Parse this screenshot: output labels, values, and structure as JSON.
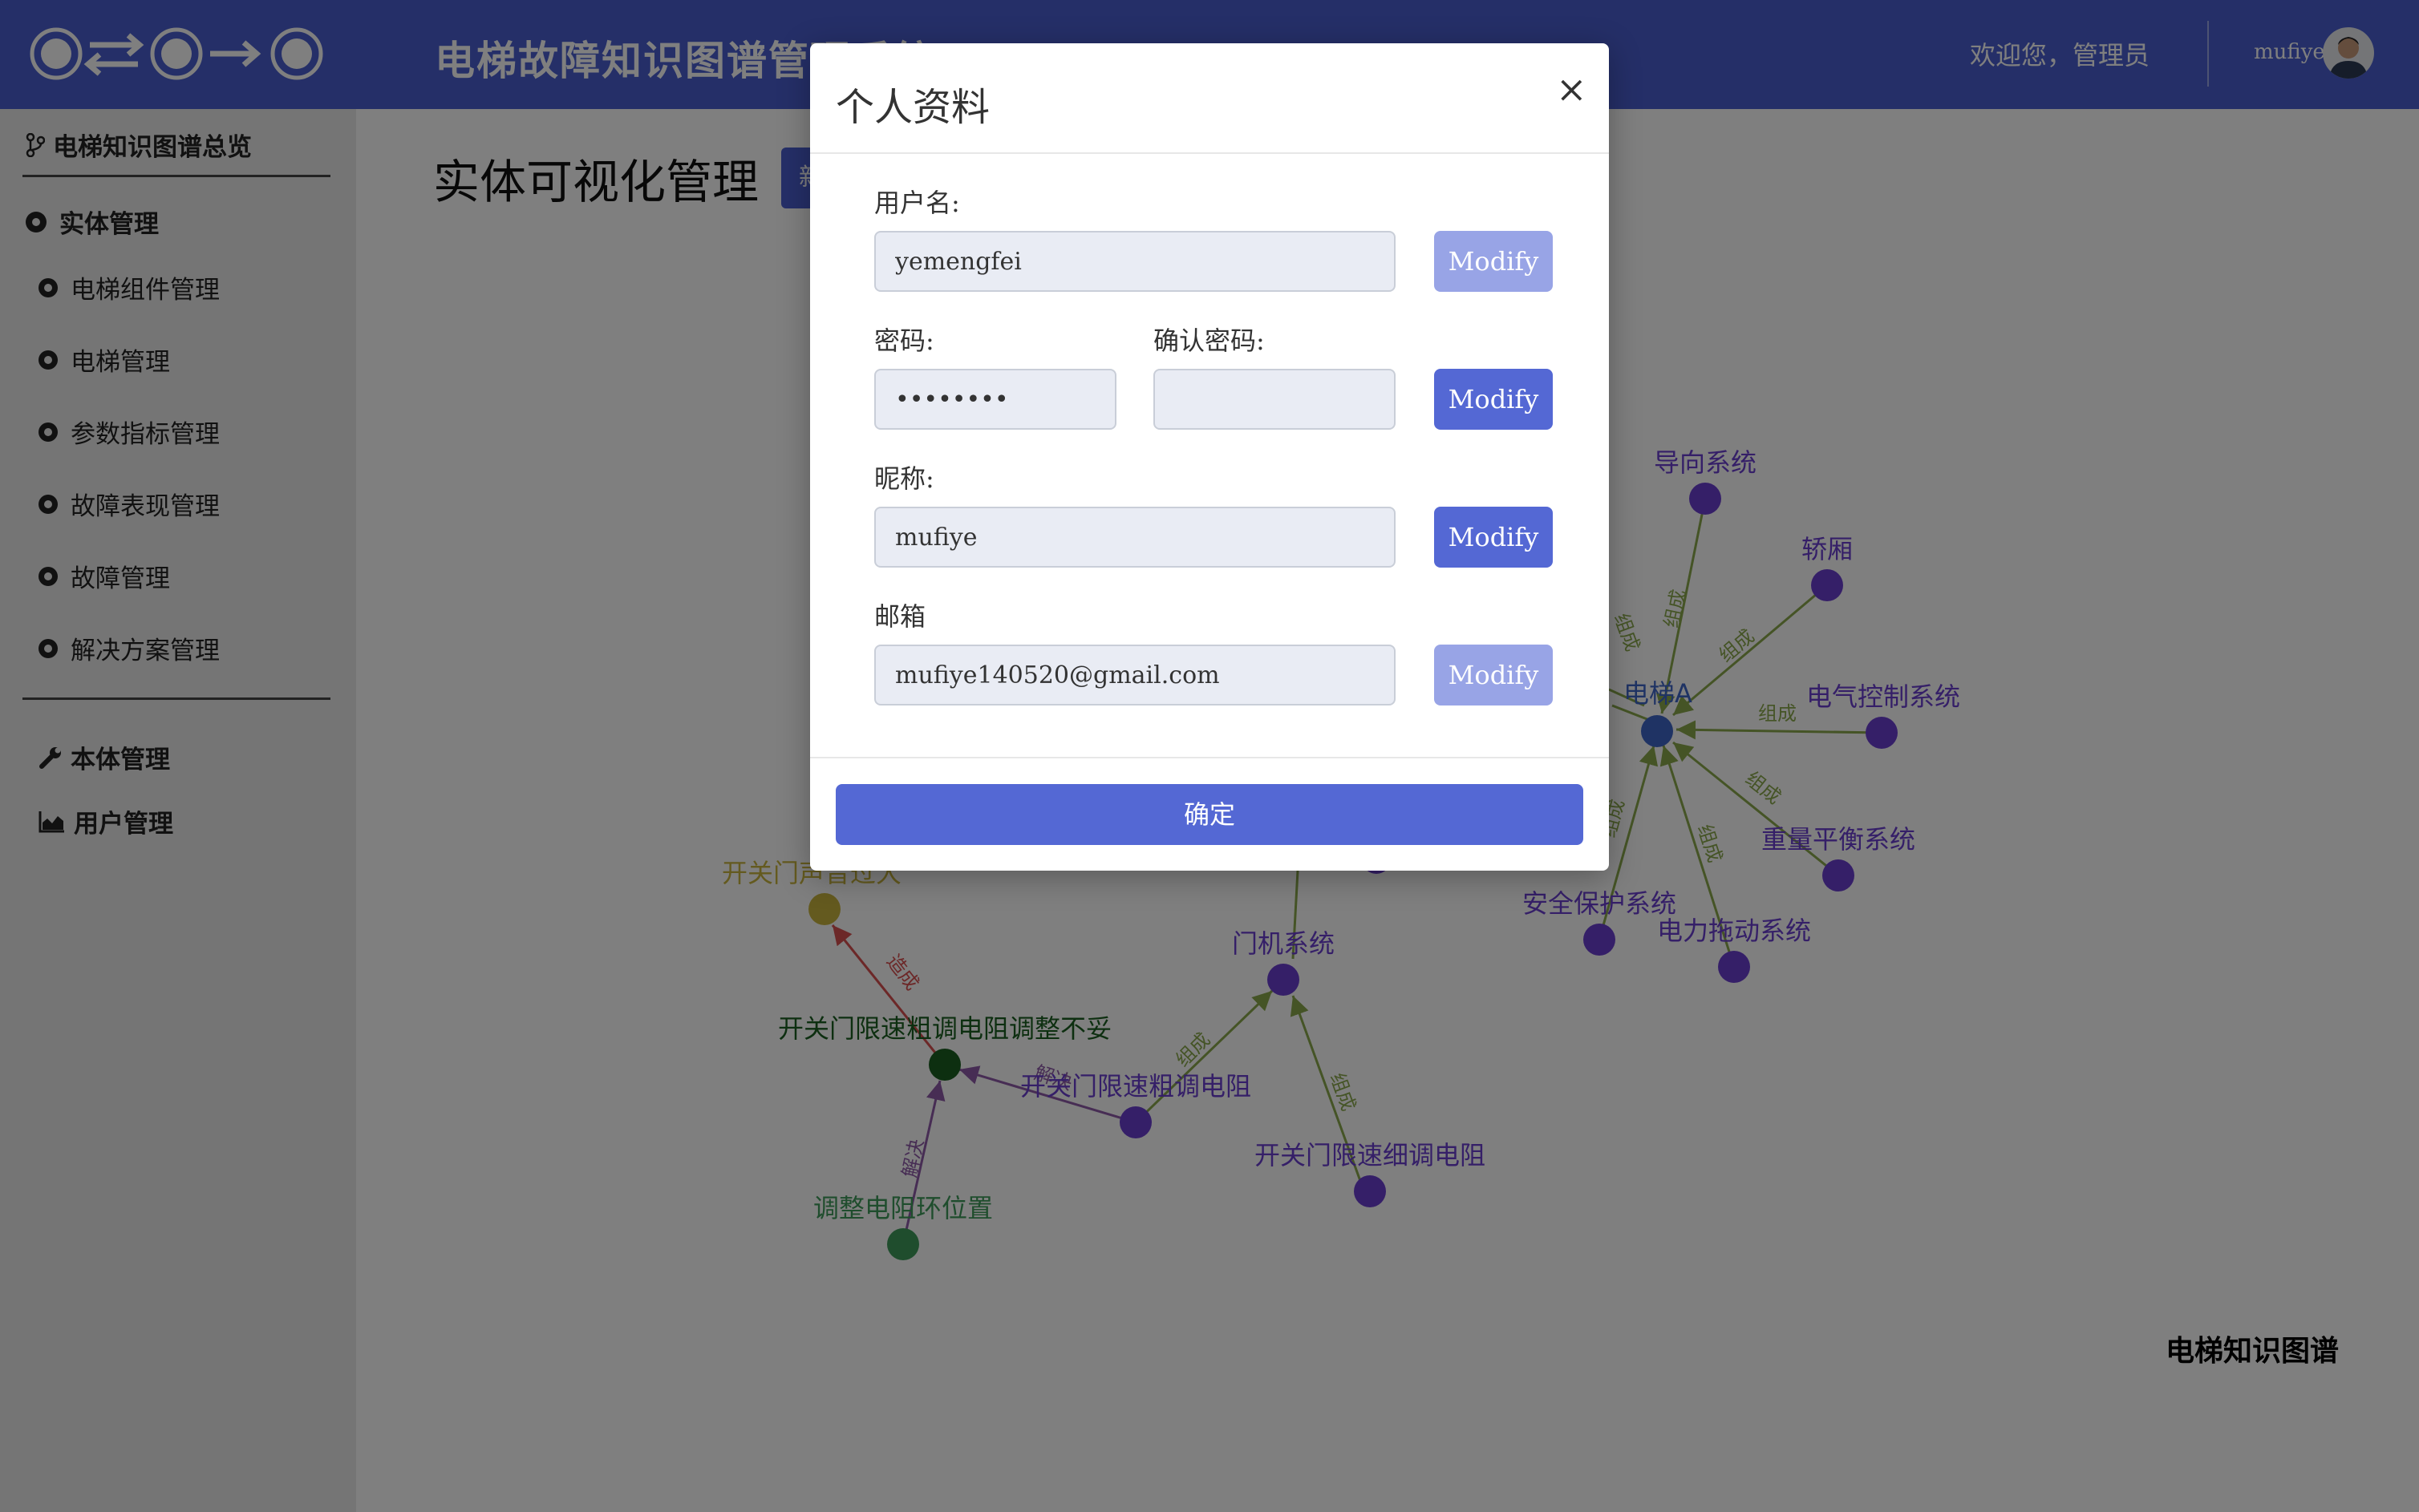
{
  "header": {
    "title": "电梯故障知识图谱管理系统",
    "welcome": "欢迎您，管理员",
    "username": "mufiye"
  },
  "sidebar": {
    "overview": "电梯知识图谱总览",
    "entity_management": "实体管理",
    "items": [
      {
        "label": "电梯组件管理"
      },
      {
        "label": "电梯管理"
      },
      {
        "label": "参数指标管理"
      },
      {
        "label": "故障表现管理"
      },
      {
        "label": "故障管理"
      },
      {
        "label": "解决方案管理"
      }
    ],
    "ontology": "本体管理",
    "users": "用户管理"
  },
  "main": {
    "title": "实体可视化管理",
    "new_button": "新",
    "graph_caption": "电梯知识图谱"
  },
  "graph": {
    "nodes": [
      {
        "id": "elevatorA",
        "label": "电梯A"
      },
      {
        "id": "guide",
        "label": "导向系统"
      },
      {
        "id": "car",
        "label": "轿厢"
      },
      {
        "id": "electric",
        "label": "电气控制系统"
      },
      {
        "id": "weight",
        "label": "重量平衡系统"
      },
      {
        "id": "power",
        "label": "电力拖动系统"
      },
      {
        "id": "safety",
        "label": "安全保护系统"
      },
      {
        "id": "door",
        "label": "门机系统"
      },
      {
        "id": "coarse",
        "label": "开关门限速粗调电阻"
      },
      {
        "id": "fine",
        "label": "开关门限速细调电阻"
      },
      {
        "id": "fault",
        "label": "开关门限速粗调电阻调整不妥"
      },
      {
        "id": "symptom",
        "label": "开关门声音过大"
      },
      {
        "id": "solution",
        "label": "调整电阻环位置"
      }
    ],
    "edges": [
      {
        "label": "组成"
      },
      {
        "label": "造成"
      },
      {
        "label": "解决"
      }
    ]
  },
  "modal": {
    "title": "个人资料",
    "close": "×",
    "username_label": "用户名:",
    "username_value": "yemengfei",
    "password_label": "密码:",
    "password_value": "12345678",
    "confirm_password_label": "确认密码:",
    "confirm_password_value": "",
    "nickname_label": "昵称:",
    "nickname_value": "mufiye",
    "email_label": "邮箱",
    "email_value": "mufiye140520@gmail.com",
    "modify_label": "Modify",
    "confirm_label": "确定"
  },
  "colors": {
    "header_bg": "#4a5fd0",
    "button_active": "#5468d4",
    "button_disabled": "#98a4e6",
    "node_purple": "#6a3fd0",
    "node_center": "#3f66c9",
    "node_fault": "#1b5e20",
    "node_solution": "#3e9a5a",
    "node_symptom": "#c9b53f",
    "edge_compose": "#8aa84c",
    "edge_cause": "#d85050",
    "edge_solve": "#8e5ba8"
  }
}
